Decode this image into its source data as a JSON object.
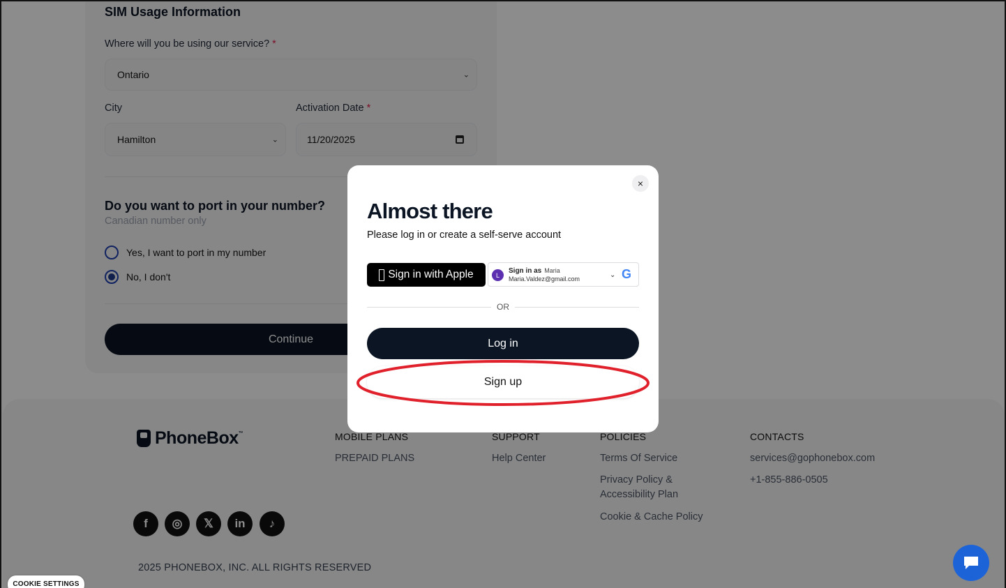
{
  "form": {
    "section_title": "SIM Usage Information",
    "location_label": "Where will you be using our service?",
    "required_mark": "*",
    "location_value": "Ontario",
    "city_label": "City",
    "city_value": "Hamilton",
    "activation_label": "Activation Date",
    "activation_value": "11/20/2025",
    "port_question": "Do you want to port in your number?",
    "port_subtitle": "Canadian number only",
    "port_options": [
      {
        "label": "Yes, I want to port in my number",
        "selected": false
      },
      {
        "label": "No, I don't",
        "selected": true
      }
    ],
    "continue_label": "Continue"
  },
  "modal": {
    "title": "Almost there",
    "subtitle": "Please log in or create a self-serve account",
    "apple_label": "Sign in with Apple",
    "google": {
      "avatar_letter": "L",
      "signin_as": "Sign in as",
      "name": "Maria",
      "email": "Maria.Valdez@gmail.com"
    },
    "or_label": "OR",
    "login_label": "Log in",
    "signup_label": "Sign up",
    "close_glyph": "×",
    "annotation_color": "#e0202a"
  },
  "footer": {
    "brand": "PhoneBox",
    "brand_tm": "™",
    "columns": [
      {
        "heading": "MOBILE PLANS",
        "links": [
          "PREPAID PLANS"
        ]
      },
      {
        "heading": "SUPPORT",
        "links": [
          "Help Center"
        ]
      },
      {
        "heading": "POLICIES",
        "links": [
          "Terms Of Service",
          "Privacy Policy & Accessibility Plan",
          "Cookie & Cache Policy"
        ]
      },
      {
        "heading": "CONTACTS",
        "links": [
          "services@gophonebox.com",
          "+1-855-886-0505"
        ]
      }
    ],
    "social_icons": [
      "facebook-icon",
      "instagram-icon",
      "x-icon",
      "linkedin-icon",
      "tiktok-icon"
    ],
    "social_glyphs": [
      "f",
      "◎",
      "𝕏",
      "in",
      "♪"
    ],
    "copyright": "2025 PHONEBOX, INC. ALL RIGHTS RESERVED"
  },
  "cookie_settings_label": "COOKIE SETTINGS",
  "colors": {
    "primary_dark": "#0b1524",
    "chat_blue": "#1d63d8",
    "required_red": "#e11d48"
  }
}
